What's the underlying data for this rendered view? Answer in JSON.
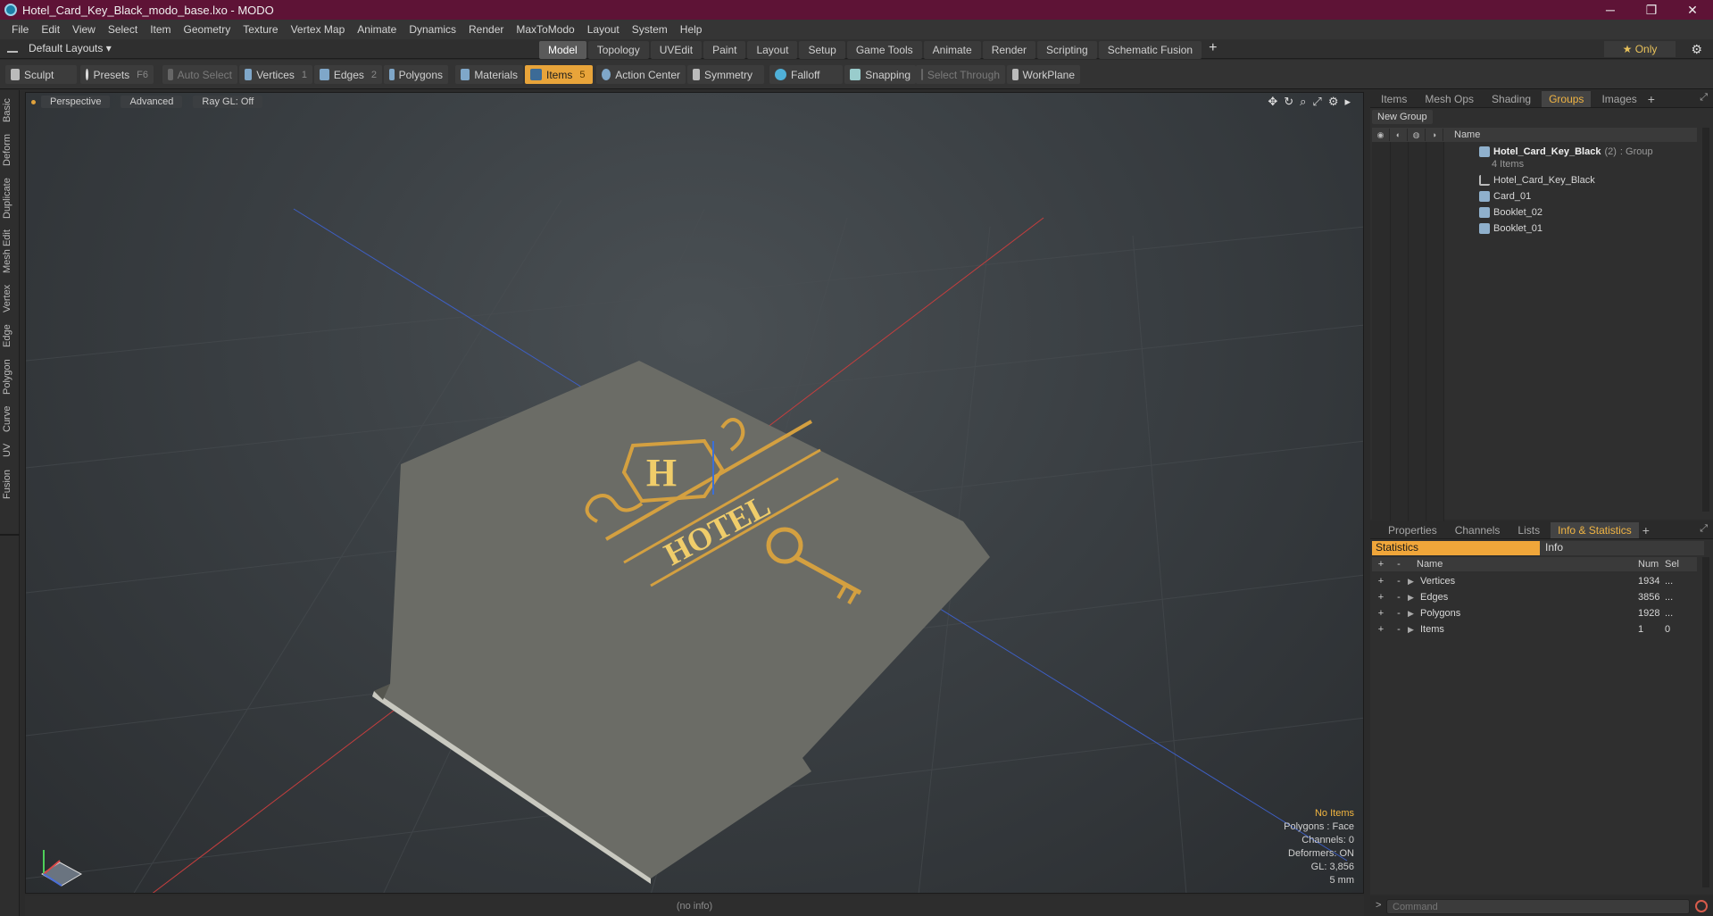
{
  "window": {
    "title": "Hotel_Card_Key_Black_modo_base.lxo - MODO",
    "controls": [
      "─",
      "❐",
      "✕"
    ]
  },
  "menu": [
    "File",
    "Edit",
    "View",
    "Select",
    "Item",
    "Geometry",
    "Texture",
    "Vertex Map",
    "Animate",
    "Dynamics",
    "Render",
    "MaxToModo",
    "Layout",
    "System",
    "Help"
  ],
  "layouts": {
    "label": "Default Layouts ▾"
  },
  "tabs": [
    "Model",
    "Topology",
    "UVEdit",
    "Paint",
    "Layout",
    "Setup",
    "Game Tools",
    "Animate",
    "Render",
    "Scripting",
    "Schematic Fusion"
  ],
  "tabs_plus": "+",
  "only_label": "★  Only",
  "toolbar": {
    "sculpt": "Sculpt",
    "presets": "Presets",
    "presets_key": "F6",
    "auto_select": "Auto Select",
    "vertices": "Vertices",
    "vertices_key": "1",
    "edges": "Edges",
    "edges_key": "2",
    "polygons": "Polygons",
    "materials": "Materials",
    "items": "Items",
    "items_key": "5",
    "action_center": "Action Center",
    "symmetry": "Symmetry",
    "falloff": "Falloff",
    "snapping": "Snapping",
    "select_through": "Select Through",
    "workplane": "WorkPlane"
  },
  "left_tabs": [
    "Basic",
    "Deform",
    "Duplicate",
    "Mesh Edit",
    "Vertex",
    "Edge",
    "Polygon",
    "Curve",
    "UV",
    "Fusion"
  ],
  "viewport": {
    "perspective": "Perspective",
    "advanced": "Advanced",
    "raygl": "Ray GL: Off",
    "card_text": "HOTEL",
    "card_letter": "H",
    "info": {
      "no_items": "No Items",
      "polygons": "Polygons : Face",
      "channels": "Channels: 0",
      "deformers": "Deformers: ON",
      "gl": "GL: 3,856",
      "scale": "5 mm"
    }
  },
  "status": "(no info)",
  "groups_panel": {
    "tabs": [
      "Items",
      "Mesh Ops",
      "Shading",
      "Groups",
      "Images"
    ],
    "active": "Groups",
    "new_group": "New Group",
    "name_header": "Name",
    "group": {
      "name": "Hotel_Card_Key_Black",
      "count": "(2)",
      "kind": ": Group",
      "items": "4 Items"
    },
    "children": [
      "Hotel_Card_Key_Black",
      "Card_01",
      "Booklet_02",
      "Booklet_01"
    ]
  },
  "stats_panel": {
    "tabs": [
      "Properties",
      "Channels",
      "Lists",
      "Info & Statistics"
    ],
    "active": "Info & Statistics",
    "statistics": "Statistics",
    "info": "Info",
    "headers": {
      "name": "Name",
      "num": "Num",
      "sel": "Sel"
    },
    "rows": [
      {
        "name": "Vertices",
        "num": "1934",
        "sel": "..."
      },
      {
        "name": "Edges",
        "num": "3856",
        "sel": "..."
      },
      {
        "name": "Polygons",
        "num": "1928",
        "sel": "..."
      },
      {
        "name": "Items",
        "num": "1",
        "sel": "0"
      }
    ]
  },
  "command": {
    "prompt": ">",
    "placeholder": "Command"
  }
}
